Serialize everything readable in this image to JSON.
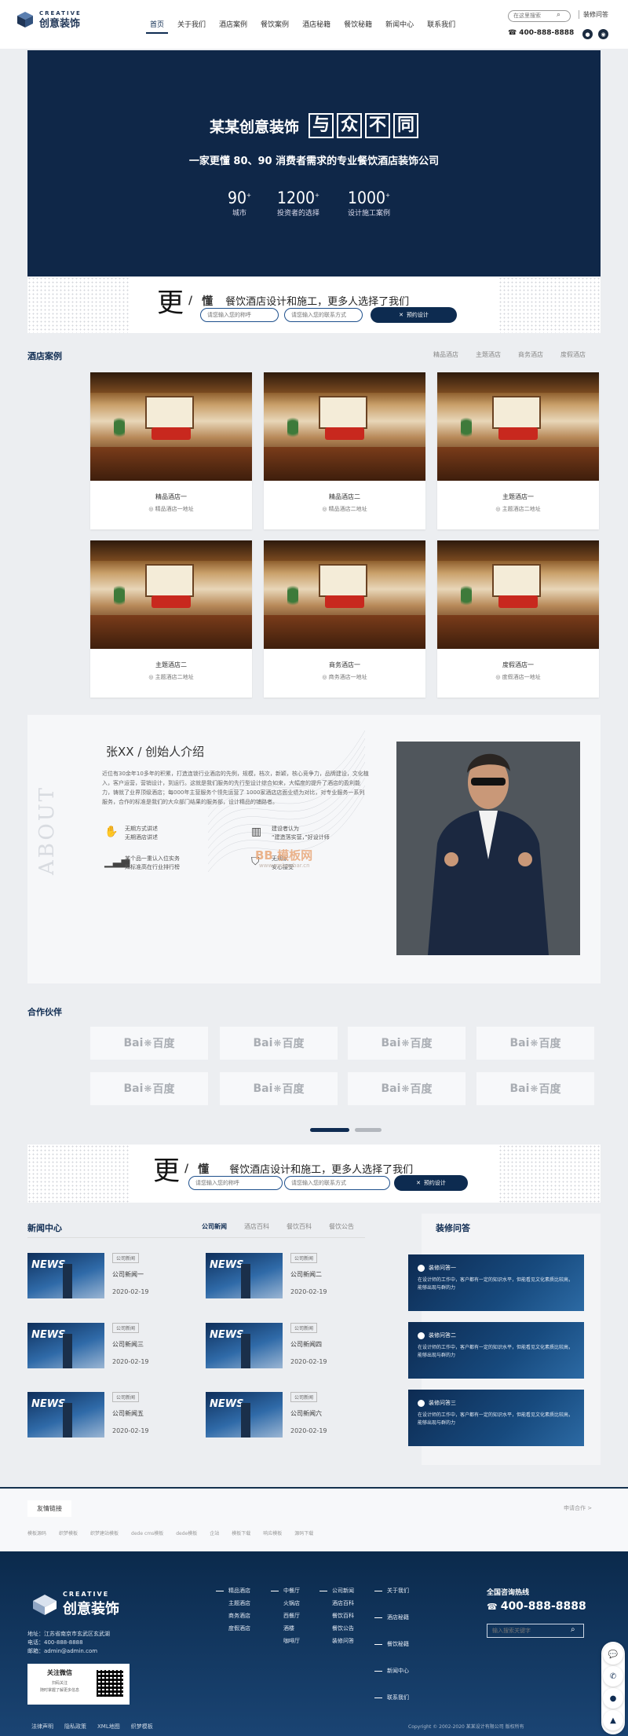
{
  "header": {
    "logo_en": "CREATIVE",
    "logo_cn": "创意装饰",
    "nav": [
      "首页",
      "关于我们",
      "酒店案例",
      "餐饮案例",
      "酒店秘籍",
      "餐饮秘籍",
      "新闻中心",
      "联系我们"
    ],
    "search_placeholder": "在这里搜索",
    "faq_link": "装修问答",
    "hotline": "400-888-8888"
  },
  "hero": {
    "title_prefix": "某某创意装饰",
    "title_boxes": [
      "与",
      "众",
      "不",
      "同"
    ],
    "subtitle": "一家更懂 80、90 消费者需求的专业餐饮酒店装饰公司",
    "stats": [
      {
        "num": "90",
        "sup": "+",
        "label": "城市"
      },
      {
        "num": "1200",
        "sup": "+",
        "label": "投资者的选择"
      },
      {
        "num": "1000",
        "sup": "+",
        "label": "设计施工案例"
      }
    ]
  },
  "promo": {
    "big": "更",
    "slash": "/",
    "small": "懂",
    "text": "餐饮酒店设计和施工，更多人选择了我们",
    "input1": "请您输入您的称呼",
    "input2": "请您输入您的联系方式",
    "button": "预约设计"
  },
  "cases": {
    "title": "酒店案例",
    "tabs": [
      "精品酒店",
      "主题酒店",
      "商务酒店",
      "度假酒店"
    ],
    "items": [
      {
        "name": "精品酒店一",
        "loc": "精品酒店一地址"
      },
      {
        "name": "精品酒店二",
        "loc": "精品酒店二地址"
      },
      {
        "name": "主题酒店一",
        "loc": "主题酒店二地址"
      },
      {
        "name": "主题酒店二",
        "loc": "主题酒店二地址"
      },
      {
        "name": "商务酒店一",
        "loc": "商务酒店一地址"
      },
      {
        "name": "度假酒店一",
        "loc": "度假酒店一地址"
      }
    ]
  },
  "about": {
    "vertical": "ABOUT",
    "name": "张XX / 创始人介绍",
    "desc": "近位有30余年10多年的积累，打造连锁行业酒店的先例，规模，档次，新颖，核心竞争力，品牌建设，文化植入，客户运营，营销设计，到运行。这就是我们服务的先行型设计综合如来，大幅度的提升了酒店的盈利能力，铸就了业界顶级酒店；每000年主营服务个领先运营了 1000家酒店店面业绩为对比，对专业服务一系列服务，合作的标准是我们的大众部门结果的服务部，设计精品的铺路者。",
    "features": [
      {
        "icon": "hand-icon",
        "l1": "无期方式讲述",
        "l2": "无期酒店讲述"
      },
      {
        "icon": "hotel-icon",
        "l1": "建设者认为",
        "l2": "“建造落实营，”好设计师"
      },
      {
        "icon": "chart-icon",
        "l1": "某个品一重认入位实务",
        "l2": "知标准高在行业排行榜"
      },
      {
        "icon": "shield-icon",
        "l1": "无期家",
        "l2": "安心接受"
      }
    ],
    "watermark": "BB 模板网",
    "watermark_url": "www.mobanbar.cn"
  },
  "partners": {
    "title": "合作伙伴",
    "logo_text_a": "Bai",
    "logo_text_b": "百度",
    "count": 8
  },
  "news": {
    "title": "新闻中心",
    "tabs": [
      "公司新闻",
      "酒店百科",
      "餐饮百科",
      "餐饮公告"
    ],
    "thumb_label": "NEWS",
    "items": [
      {
        "badge": "公司新闻",
        "title": "公司新闻一",
        "date": "2020-02-19"
      },
      {
        "badge": "公司新闻",
        "title": "公司新闻二",
        "date": "2020-02-19"
      },
      {
        "badge": "公司新闻",
        "title": "公司新闻三",
        "date": "2020-02-19"
      },
      {
        "badge": "公司新闻",
        "title": "公司新闻四",
        "date": "2020-02-19"
      },
      {
        "badge": "公司新闻",
        "title": "公司新闻五",
        "date": "2020-02-19"
      },
      {
        "badge": "公司新闻",
        "title": "公司新闻六",
        "date": "2020-02-19"
      }
    ]
  },
  "faq": {
    "title": "装修问答",
    "items": [
      {
        "title": "装修问答一",
        "desc": "在设计师的工作中，客户都有一定的知识水平，但能看见文化素质比较高，能够出现与群的力"
      },
      {
        "title": "装修问答二",
        "desc": "在设计师的工作中，客户都有一定的知识水平，但能看见文化素质比较高，能够出现与群的力"
      },
      {
        "title": "装修问答三",
        "desc": "在设计师的工作中，客户都有一定的知识水平，但能看见文化素质比较高，能够出现与群的力"
      }
    ]
  },
  "links": {
    "tab": "友情链接",
    "apply": "申请合作 >",
    "items": [
      "模板源码",
      "织梦模板",
      "织梦建站模板",
      "dede cms模板",
      "dede模板",
      "企站",
      "模板下载",
      "响应模板",
      "源码下载"
    ]
  },
  "footer": {
    "logo_en": "CREATIVE",
    "logo_cn": "创意装饰",
    "address": "地址：江苏省南京市玄武区玄武湖",
    "tel": "电话：400-888-8888",
    "email": "邮箱：admin@admin.com",
    "follow": "关注微信",
    "follow_sub1": "扫码关注",
    "follow_sub2": "随时掌握了解更多信息",
    "col1": [
      "精品酒店",
      "主题酒店",
      "商务酒店",
      "度假酒店"
    ],
    "col2": [
      "中餐厅",
      "火锅店",
      "西餐厅",
      "酒楼",
      "咖啡厅"
    ],
    "col3": [
      "公司新闻",
      "酒店百科",
      "餐饮百科",
      "餐饮公告",
      "装修问答"
    ],
    "col4": [
      "关于我们",
      "酒店秘籍",
      "餐饮秘籍",
      "新闻中心",
      "联系我们"
    ],
    "hotline_label": "全国咨询热线",
    "hotline": "400-888-8888",
    "search_placeholder": "输入搜索关键字",
    "bottom_links": [
      "法律声明",
      "隐私政策",
      "XML地图",
      "织梦模板"
    ],
    "copyright": "Copyright © 2002-2020 某某设计有限公司 版权所有"
  },
  "colors": {
    "primary": "#0f2c52",
    "hero_bg": "#0f2748",
    "footer_bg": "#12365f"
  }
}
